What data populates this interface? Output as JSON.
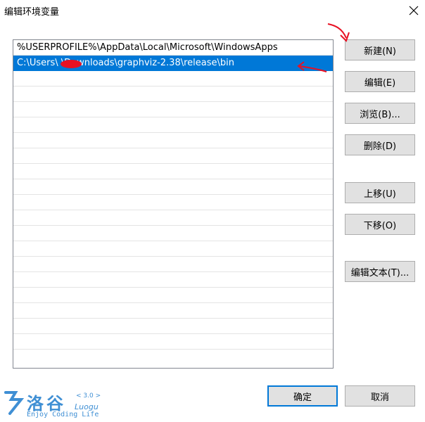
{
  "dialog": {
    "title": "编辑环境变量"
  },
  "list": {
    "items": [
      "%USERPROFILE%\\AppData\\Local\\Microsoft\\WindowsApps",
      "C:\\Users\\        \\Downloads\\graphviz-2.38\\release\\bin"
    ],
    "empty_rows": 18
  },
  "buttons": {
    "new": "新建(N)",
    "edit": "编辑(E)",
    "browse": "浏览(B)...",
    "delete": "删除(D)",
    "move_up": "上移(U)",
    "move_down": "下移(O)",
    "edit_text": "编辑文本(T)...",
    "ok": "确定",
    "cancel": "取消"
  },
  "watermark": {
    "name": "洛谷",
    "version": "< 3.0 >",
    "latin": "Luogu",
    "tagline": "Enjoy Coding Life"
  },
  "colors": {
    "selection": "#0078d7",
    "annotation": "#e81123",
    "logo": "#3f8fd4"
  }
}
